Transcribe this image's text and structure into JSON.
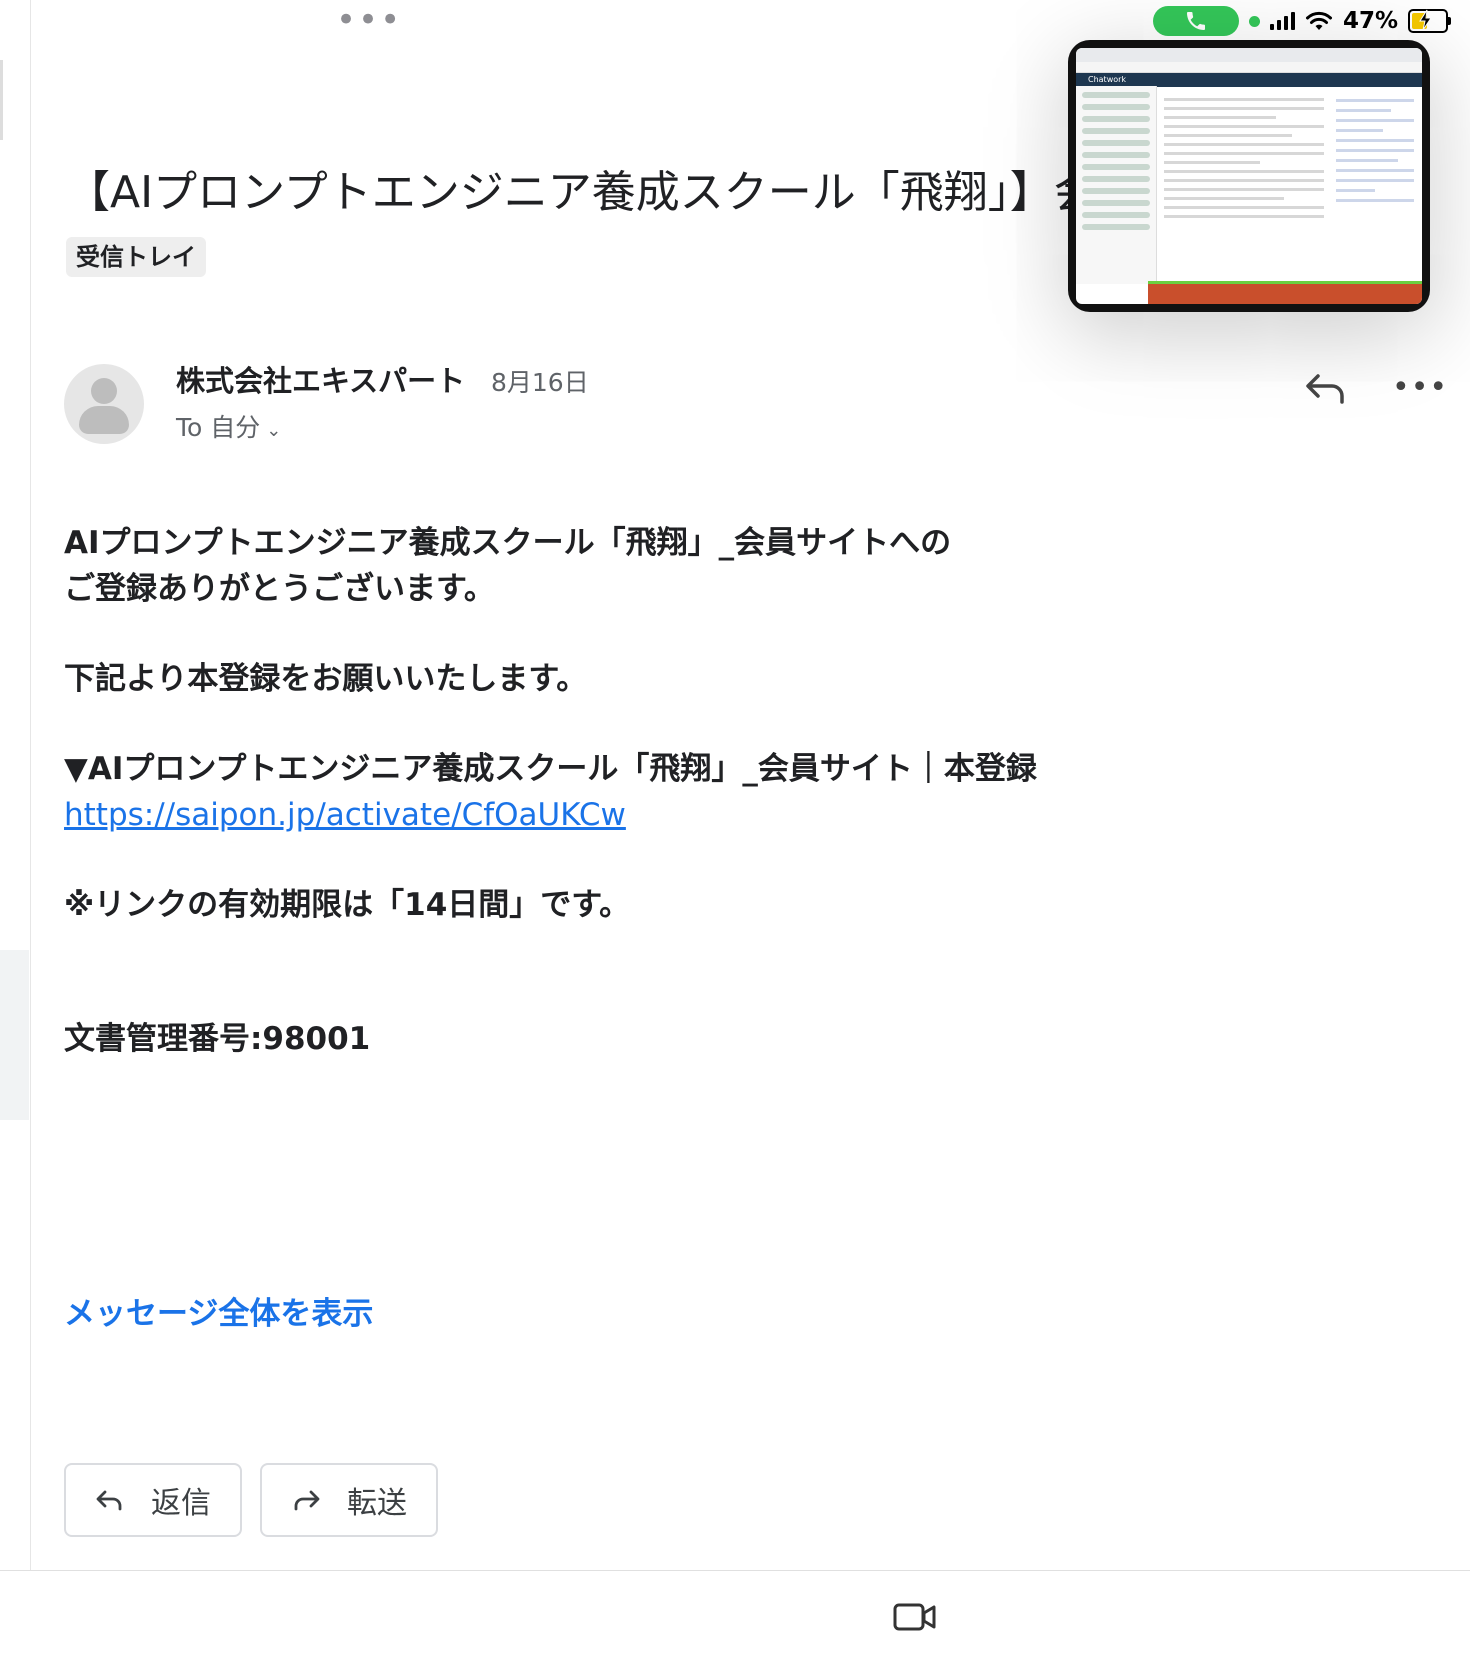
{
  "status_bar": {
    "battery_percent": "47%",
    "battery_level": 0.47,
    "colors": {
      "call_pill": "#34c759",
      "battery_fill": "#f6c900"
    }
  },
  "email": {
    "subject": "【AIプロンプトエンジニア養成スクール「飛翔」】会員登録のご案内",
    "label": "受信トレイ",
    "sender": "株式会社エキスパート",
    "date": "8月16日",
    "recipient": "To 自分",
    "body": {
      "line1": "AIプロンプトエンジニア養成スクール「飛翔」_会員サイトへの",
      "line2": "ご登録ありがとうございます。",
      "line3": "下記より本登録をお願いいたします。",
      "line4": "▼AIプロンプトエンジニア養成スクール「飛翔」_会員サイト｜本登録",
      "link": "https://saipon.jp/activate/CfOaUKCw",
      "line5": "※リンクの有効期限は「14日間」です。",
      "line6": "文書管理番号:98001"
    },
    "show_full_message": "メッセージ全体を表示"
  },
  "actions": {
    "reply_label": "返信",
    "forward_label": "転送"
  },
  "pip": {
    "app_name": "Chatwork"
  },
  "icons": {
    "multitask": "ellipsis-icon",
    "call": "phone-icon",
    "wifi": "wifi-icon",
    "signal": "cellular-signal-icon",
    "battery": "battery-charging-icon",
    "reply": "reply-arrow-icon",
    "more": "more-horizontal-icon",
    "forward": "forward-arrow-icon",
    "video": "video-camera-icon"
  },
  "colors": {
    "link": "#1a73e8",
    "text": "#202124",
    "muted": "#5f6368"
  }
}
